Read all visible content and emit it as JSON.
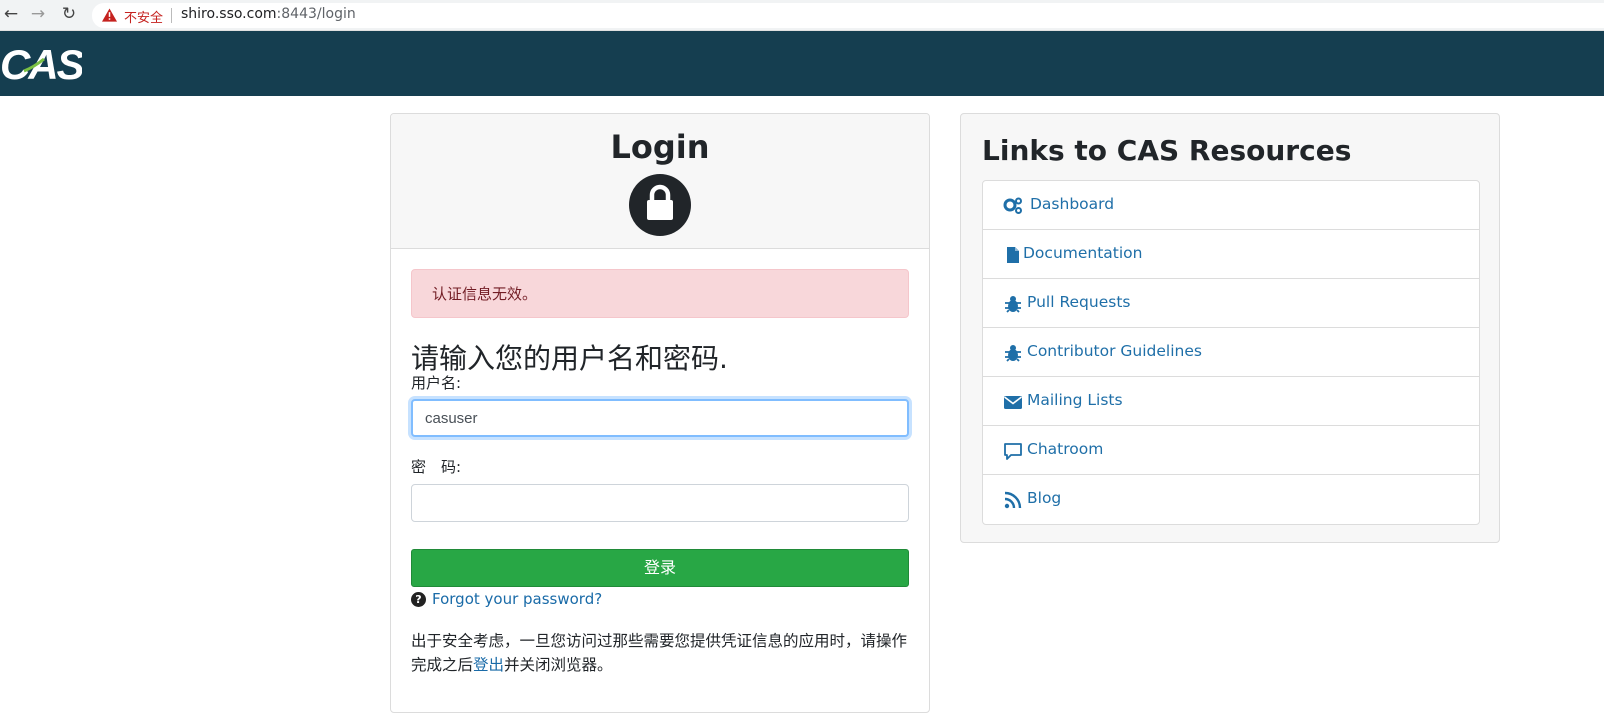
{
  "browser": {
    "back_icon": "back-arrow-icon",
    "forward_icon": "forward-arrow-icon",
    "reload_icon": "reload-icon",
    "security_label": "不安全",
    "url_host": "shiro.sso.com",
    "url_path": ":8443/login"
  },
  "header": {
    "logo_text": "CAS",
    "background": "#153e50"
  },
  "login": {
    "title": "Login",
    "lock_icon": "lock-icon",
    "alert": "认证信息无效。",
    "prompt": "请输入您的用户名和密码.",
    "username_label": "用户名:",
    "username_value": "casuser",
    "password_label": "密　码:",
    "password_value": "",
    "submit_label": "登录",
    "forgot_label": "Forgot your password?",
    "notice_before": "出于安全考虑，一旦您访问过那些需要您提供凭证信息的应用时，请操作完成之后",
    "notice_link": "登出",
    "notice_after": "并关闭浏览器。"
  },
  "resources": {
    "title": "Links to CAS Resources",
    "items": [
      {
        "label": "Dashboard",
        "icon": "gears-icon"
      },
      {
        "label": "Documentation",
        "icon": "file-icon"
      },
      {
        "label": "Pull Requests",
        "icon": "bug-icon"
      },
      {
        "label": "Contributor Guidelines",
        "icon": "bug-icon"
      },
      {
        "label": "Mailing Lists",
        "icon": "envelope-icon"
      },
      {
        "label": "Chatroom",
        "icon": "chat-icon"
      },
      {
        "label": "Blog",
        "icon": "rss-icon"
      }
    ]
  },
  "colors": {
    "accent_link": "#1f6fa8",
    "submit": "#28a745",
    "alert_bg": "#f8d7da",
    "alert_text": "#721c24"
  }
}
